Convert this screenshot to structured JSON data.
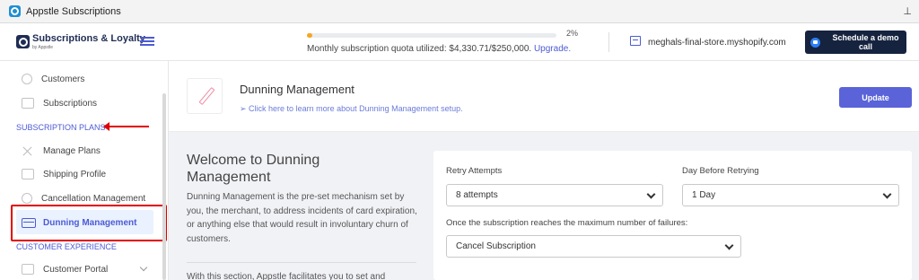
{
  "window": {
    "title": "Appstle Subscriptions",
    "pin_icon": "pin-icon"
  },
  "header": {
    "brand": "Subscriptions & Loyalty",
    "brand_sub": "by Appstle",
    "quota_progress": 0.02,
    "quota_percent": "2%",
    "quota_text": "Monthly subscription quota utilized: $4,330.71/$250,000.",
    "quota_link": "Upgrade.",
    "store": "meghals-final-store.myshopify.com",
    "demo_button": "Schedule a demo call"
  },
  "sidebar": {
    "items": [
      {
        "label": "Customers"
      },
      {
        "label": "Subscriptions"
      }
    ],
    "section_plans": "SUBSCRIPTION PLANS",
    "plan_items": [
      {
        "label": "Manage Plans"
      },
      {
        "label": "Shipping Profile"
      },
      {
        "label": "Cancellation Management"
      },
      {
        "label": "Dunning Management",
        "active": true
      }
    ],
    "section_experience": "CUSTOMER EXPERIENCE",
    "experience_items": [
      {
        "label": "Customer Portal"
      }
    ]
  },
  "page": {
    "title": "Dunning Management",
    "help_link": "Click here to learn more about Dunning Management setup.",
    "update_button": "Update"
  },
  "welcome": {
    "title": "Welcome to Dunning Management",
    "description": "Dunning Management is the pre-set mechanism set by you, the merchant, to address incidents of card expiration, or anything else that would result in involuntary churn of customers.",
    "more": "With this section, Appstle facilitates you to set and"
  },
  "form": {
    "retry_label": "Retry Attempts",
    "retry_value": "8 attempts",
    "day_label": "Day Before Retrying",
    "day_value": "1 Day",
    "max_fail_label": "Once the subscription reaches the maximum number of failures:",
    "max_fail_value": "Cancel Subscription"
  },
  "colors": {
    "accent": "#4c5bd4",
    "annotation": "#e00000",
    "demo_button": "#15233f"
  }
}
